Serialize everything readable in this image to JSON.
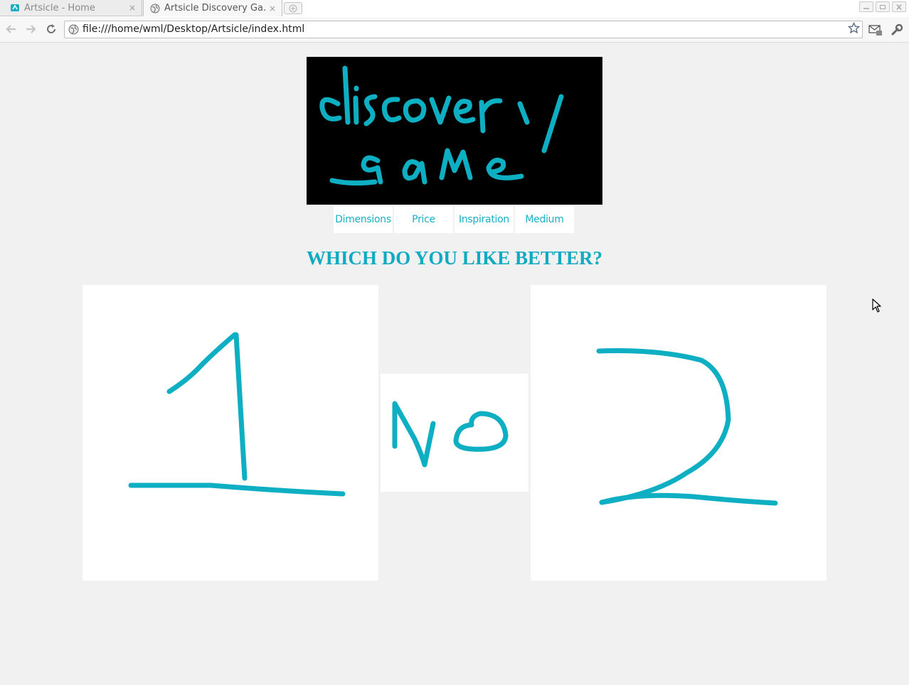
{
  "browser": {
    "tabs": [
      {
        "title": "Artsicle - Home",
        "close": "×"
      },
      {
        "title": "Artsicle Discovery Ga...",
        "close": "×"
      }
    ],
    "url": "file:///home/wml/Desktop/Artsicle/index.html",
    "icons": [
      "back-icon",
      "forward-icon",
      "reload-icon",
      "page-icon",
      "star-icon",
      "mail-icon",
      "wrench-icon",
      "new-tab-icon"
    ]
  },
  "page": {
    "logo_text": "discovery game",
    "nav": [
      "Dimensions",
      "Price",
      "Inspiration",
      "Medium"
    ],
    "question": "WHICH DO YOU LIKE BETTER?",
    "choices": [
      {
        "label": "1"
      },
      {
        "label": "2"
      }
    ],
    "no_label": "No"
  },
  "colors": {
    "accent": "#0eafc2",
    "background": "#f1f1f1",
    "logo_background": "#000000",
    "tile": "#ffffff"
  }
}
